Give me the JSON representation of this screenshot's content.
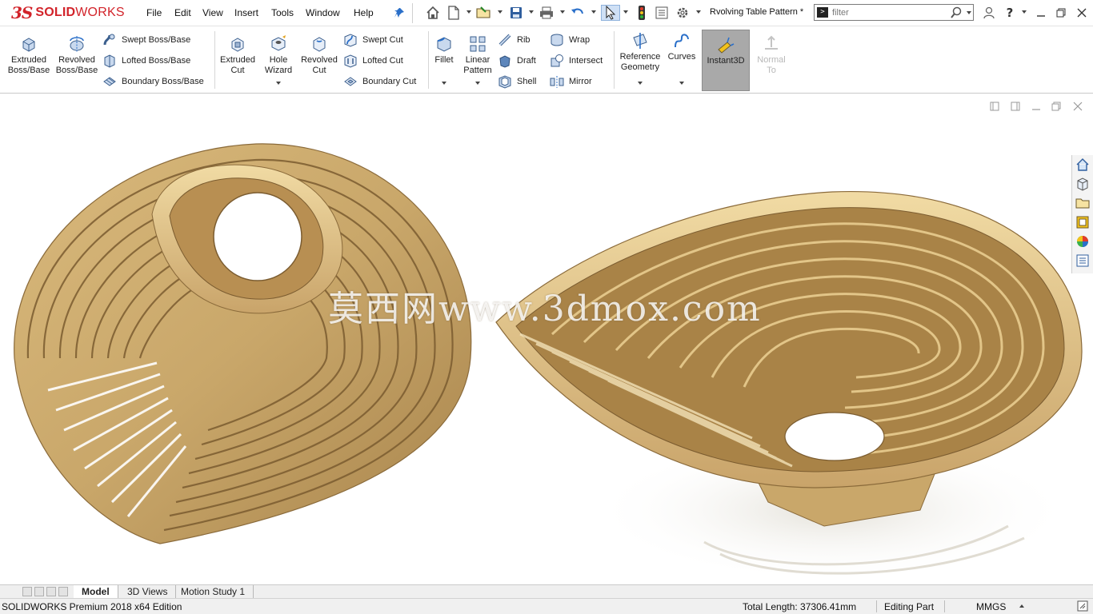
{
  "app": {
    "logo_ds": "3S",
    "logo_name_bold": "SOLID",
    "logo_name_rest": "WORKS",
    "document_title": "Rvolving Table Pattern *"
  },
  "menu": [
    "File",
    "Edit",
    "View",
    "Insert",
    "Tools",
    "Window",
    "Help"
  ],
  "search": {
    "value": "filter"
  },
  "ribbon": {
    "extruded_boss": "Extruded\nBoss/Base",
    "revolved_boss": "Revolved\nBoss/Base",
    "swept_boss": "Swept Boss/Base",
    "lofted_boss": "Lofted Boss/Base",
    "boundary_boss": "Boundary Boss/Base",
    "extruded_cut": "Extruded\nCut",
    "hole_wizard": "Hole\nWizard",
    "revolved_cut": "Revolved\nCut",
    "swept_cut": "Swept Cut",
    "lofted_cut": "Lofted Cut",
    "boundary_cut": "Boundary Cut",
    "fillet": "Fillet",
    "linear_pattern": "Linear\nPattern",
    "rib": "Rib",
    "draft": "Draft",
    "shell": "Shell",
    "wrap": "Wrap",
    "intersect": "Intersect",
    "mirror": "Mirror",
    "reference_geometry": "Reference\nGeometry",
    "curves": "Curves",
    "instant3d": "Instant3D",
    "normal_to": "Normal\nTo"
  },
  "viewport": {
    "watermark": "莫西网www.3dmox.com",
    "model_color": "#c9a76a",
    "model_edge_color": "#8a6a3a"
  },
  "tabs": [
    "Model",
    "3D Views",
    "Motion Study 1"
  ],
  "status": {
    "edition": "SOLIDWORKS Premium 2018 x64 Edition",
    "total_length": "Total Length: 37306.41mm",
    "mode": "Editing Part",
    "units": "MMGS"
  },
  "colors": {
    "brand": "#d2232a",
    "highlight": "#a9a9a9"
  }
}
